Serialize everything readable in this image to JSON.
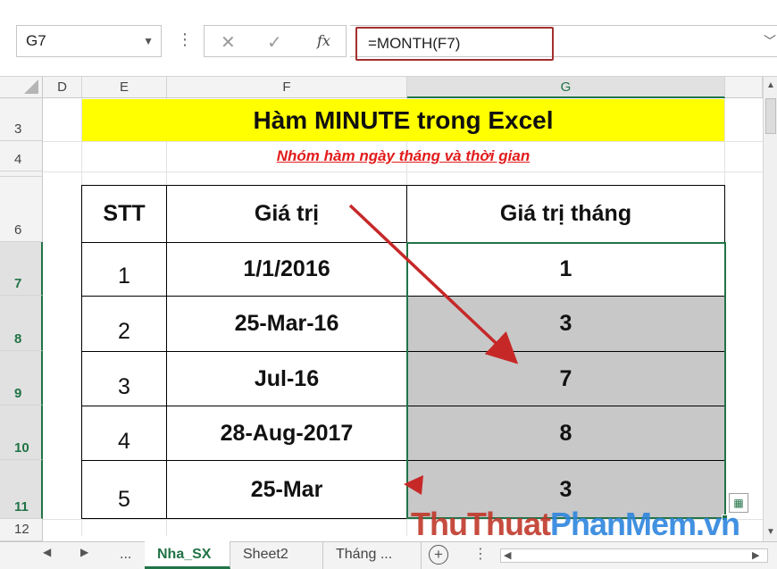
{
  "formula_bar": {
    "name_box": "G7",
    "formula": "=MONTH(F7)",
    "fx_label": "fx",
    "cancel_icon": "✕",
    "enter_icon": "✓"
  },
  "columns": [
    "D",
    "E",
    "F",
    "G"
  ],
  "rows": [
    "3",
    "4",
    "6",
    "7",
    "8",
    "9",
    "10",
    "11",
    "12"
  ],
  "sheet": {
    "title": "Hàm MINUTE trong Excel",
    "subtitle": "Nhóm hàm ngày tháng và thời gian",
    "table": {
      "headers": [
        "STT",
        "Giá trị",
        "Giá trị tháng"
      ],
      "rows": [
        {
          "stt": "1",
          "value": "1/1/2016",
          "month": "1"
        },
        {
          "stt": "2",
          "value": "25-Mar-16",
          "month": "3"
        },
        {
          "stt": "3",
          "value": "Jul-16",
          "month": "7"
        },
        {
          "stt": "4",
          "value": "28-Aug-2017",
          "month": "8"
        },
        {
          "stt": "5",
          "value": "25-Mar",
          "month": "3"
        }
      ]
    }
  },
  "tabs": [
    "...",
    "Nha_SX",
    "Sheet2",
    "Tháng ..."
  ],
  "active_tab": "Nha_SX",
  "watermark": "ThuThuatPhanMem.vn",
  "colors": {
    "accent": "#217346",
    "title_bg": "#ffff00",
    "subtitle": "#e21b1b",
    "arrow": "#c62828"
  }
}
